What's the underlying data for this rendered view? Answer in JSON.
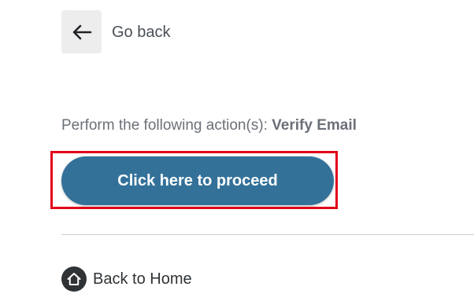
{
  "navigation": {
    "back_label": "Go back",
    "home_label": "Back to Home"
  },
  "action": {
    "prefix": "Perform the following action(s): ",
    "name": "Verify Email",
    "proceed_label": "Click here to proceed"
  },
  "colors": {
    "primary_button": "#337199",
    "highlight_border": "#e2001a",
    "back_button_bg": "#ededed"
  },
  "icons": {
    "back": "arrow-left-icon",
    "home": "home-icon"
  }
}
